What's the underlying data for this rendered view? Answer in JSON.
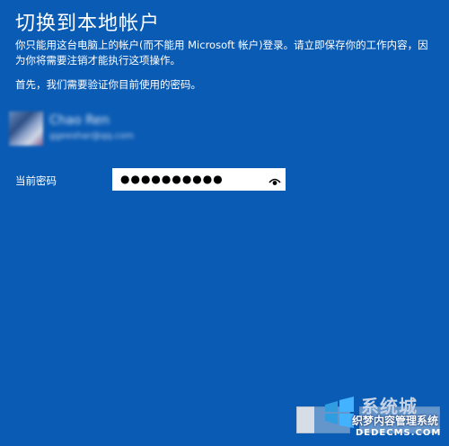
{
  "page": {
    "title": "切换到本地帐户",
    "description": "你只能用这台电脑上的帐户(而不能用 Microsoft 帐户)登录。请立即保存你的工作内容，因为你将需要注销才能执行这项操作。",
    "instruction": "首先，我们需要验证你目前使用的密码。"
  },
  "account": {
    "name": "Chao Ren",
    "email": "ggeeshar@qq.com"
  },
  "password": {
    "label": "当前密码",
    "masked_value": "●●●●●●●●●●",
    "reveal_icon": "eye-icon"
  },
  "buttons": {
    "next_label": "",
    "cancel_label": ""
  },
  "watermark": {
    "line1": "系统城",
    "line2": "织梦内容管理系统",
    "line3": "DEDECMS.COM"
  },
  "colors": {
    "background": "#0a5bb4",
    "text": "#ffffff",
    "input_bg": "#ffffff"
  }
}
